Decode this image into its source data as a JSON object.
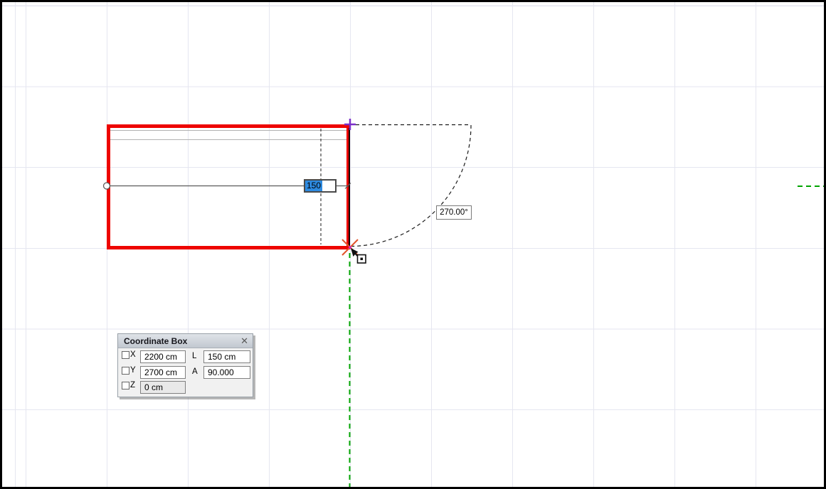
{
  "colors": {
    "wall_red": "#ee0400",
    "guide_green": "#00a400",
    "selection_blue": "#2d8ae0",
    "snap_orange": "#e2532a",
    "node_purple": "#7b2fc8",
    "grid_line": "#e5e6f0",
    "dim_gray": "#5a5a5a"
  },
  "tracker": {
    "length_value": "150"
  },
  "angle_readout": {
    "value": "270.00°"
  },
  "coordinate_box": {
    "title": "Coordinate Box",
    "close_label": "✕",
    "fields": {
      "x": {
        "label": "X",
        "value": "2200 cm"
      },
      "y": {
        "label": "Y",
        "value": "2700 cm"
      },
      "z": {
        "label": "Z",
        "value": "0 cm"
      },
      "l": {
        "label": "L",
        "value": "150 cm"
      },
      "a": {
        "label": "A",
        "value": "90.000"
      }
    }
  }
}
